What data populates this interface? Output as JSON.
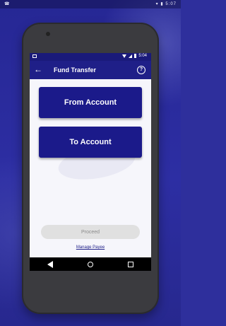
{
  "device": {
    "outer_status": {
      "left_text": "☎",
      "right_text": "▾ ▮ 5:07"
    },
    "screen_status": {
      "time": "5:04"
    }
  },
  "app_bar": {
    "title": "Fund Transfer",
    "back_icon": "arrow-left",
    "help_icon": "?"
  },
  "main": {
    "from_account_label": "From Account",
    "to_account_label": "To Account",
    "proceed_label": "Proceed",
    "manage_payee_label": "Manage Payee"
  },
  "colors": {
    "primary": "#1f1f88",
    "button": "#1b1a8a",
    "background": "#2d2ea3",
    "proceed_disabled": "#e0e0e0"
  }
}
